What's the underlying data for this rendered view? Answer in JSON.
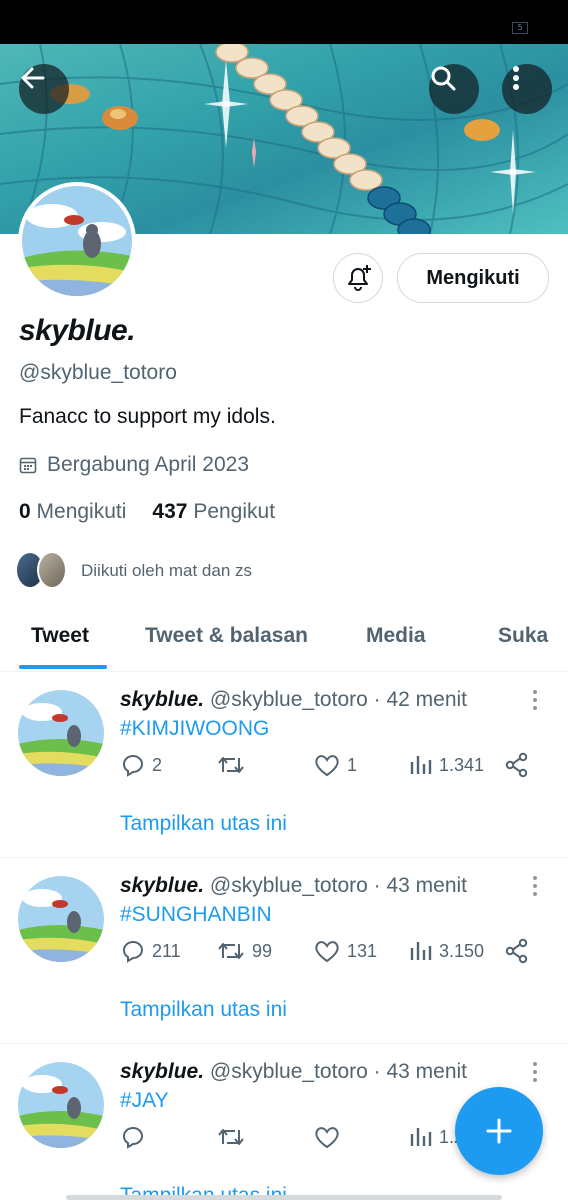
{
  "status_bar": {
    "battery_label": "5"
  },
  "header": {
    "back_icon": "arrow-left-icon",
    "search_icon": "search-icon",
    "more_icon": "more-vertical-icon"
  },
  "profile": {
    "display_name": "skyblue.",
    "handle": "@skyblue_totoro",
    "bio": "Fanacc to support my idols.",
    "joined": "Bergabung April 2023",
    "following_count": "0",
    "following_label": "Mengikuti",
    "followers_count": "437",
    "followers_label": "Pengikut",
    "followed_by": "Diikuti oleh mat dan zs",
    "follow_button": "Mengikuti",
    "notify_icon": "bell-plus-icon"
  },
  "tabs": [
    {
      "label": "Tweet",
      "active": true
    },
    {
      "label": "Tweet & balasan",
      "active": false
    },
    {
      "label": "Media",
      "active": false
    },
    {
      "label": "Suka",
      "active": false
    }
  ],
  "tweets": [
    {
      "name": "skyblue.",
      "meta": "@skyblue_totoro · 42 menit",
      "text": "#KIMJIWOONG",
      "replies": "2",
      "retweets": "",
      "likes": "1",
      "views": "1.341",
      "thread_link": "Tampilkan utas ini"
    },
    {
      "name": "skyblue.",
      "meta": "@skyblue_totoro · 43 menit",
      "text": "#SUNGHANBIN",
      "replies": "211",
      "retweets": "99",
      "likes": "131",
      "views": "3.150",
      "thread_link": "Tampilkan utas ini"
    },
    {
      "name": "skyblue.",
      "meta": "@skyblue_totoro · 43 menit",
      "text": "#JAY",
      "replies": "",
      "retweets": "",
      "likes": "",
      "views": "1.2",
      "thread_link": "Tampilkan utas ini"
    }
  ],
  "fab": {
    "icon": "plus-icon"
  },
  "colors": {
    "accent": "#1d9bf0",
    "text": "#0f1419",
    "secondary": "#536471"
  }
}
